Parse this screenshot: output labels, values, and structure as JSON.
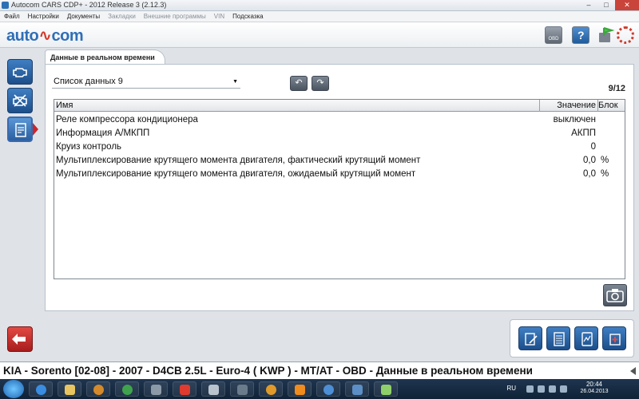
{
  "window": {
    "title": "Autocom CARS CDP+ - 2012 Release 3 (2.12.3)",
    "controls": {
      "minimize": "–",
      "maximize": "□",
      "close": "✕"
    }
  },
  "menu": [
    {
      "label": "Файл",
      "enabled": true
    },
    {
      "label": "Настройки",
      "enabled": true
    },
    {
      "label": "Документы",
      "enabled": true
    },
    {
      "label": "Закладки",
      "enabled": false
    },
    {
      "label": "Внешние программы",
      "enabled": false
    },
    {
      "label": "VIN",
      "enabled": false
    },
    {
      "label": "Подсказка",
      "enabled": true
    }
  ],
  "header": {
    "logo_left": "auto",
    "logo_mid": "∿",
    "logo_right": "com",
    "obd_label": "OBD"
  },
  "sidebar": {
    "items": [
      {
        "icon": "engine-icon",
        "active": false
      },
      {
        "icon": "engine-off-icon",
        "active": false
      },
      {
        "icon": "live-data-icon",
        "active": true
      }
    ],
    "back_icon": "back-arrow-icon"
  },
  "main": {
    "tab_label": "Данные в реальном времени",
    "select_value": "Список данных 9",
    "nav_left": "↶",
    "nav_right": "↷",
    "page_counter": "9/12",
    "table": {
      "headers": {
        "name": "Имя",
        "value": "Значение",
        "unit": "Блок"
      },
      "rows": [
        {
          "name": "Реле компрессора кондиционера",
          "value": "выключен",
          "unit": ""
        },
        {
          "name": "Информация А/МКПП",
          "value": "АКПП",
          "unit": ""
        },
        {
          "name": "Круиз контроль",
          "value": "0",
          "unit": ""
        },
        {
          "name": "Мультиплексирование крутящего момента двигателя, фактический крутящий момент",
          "value": "0,0",
          "unit": "%"
        },
        {
          "name": "Мультиплексирование крутящего момента двигателя, ожидаемый крутящий момент",
          "value": "0,0",
          "unit": "%"
        }
      ]
    }
  },
  "tools": [
    "print-report-icon",
    "list-icon",
    "graph-icon",
    "settings-icon"
  ],
  "status": {
    "text": "KIA - Sorento [02-08] - 2007 - D4CB 2.5L - Euro-4 ( KWP ) - MT/AT - OBD - Данные в реальном времени"
  },
  "taskbar": {
    "lang": "RU",
    "time": "20:44",
    "date": "26.04.2013"
  },
  "colors": {
    "brand_blue": "#2f6fb7",
    "brand_red": "#d23a2a",
    "button_blue": "#1c4e8a"
  }
}
